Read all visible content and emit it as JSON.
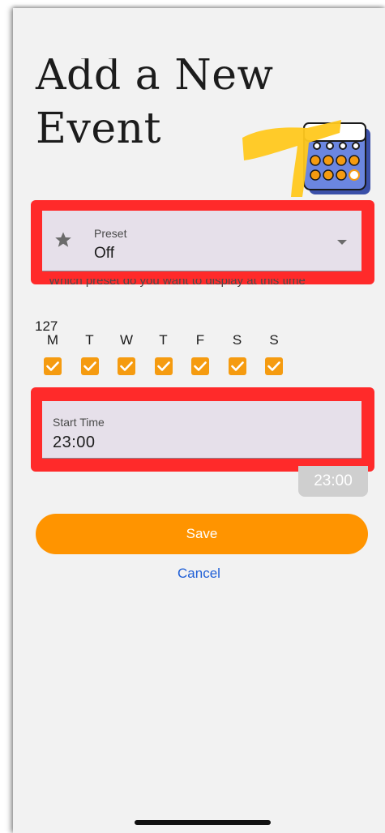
{
  "header": {
    "title_line1": "Add a New",
    "title_line2": "Event"
  },
  "preset": {
    "label": "Preset",
    "value": "Off",
    "helper": "Which preset do you want to display at this time",
    "icon": "star-icon"
  },
  "days": {
    "count": "127",
    "letters": [
      "M",
      "T",
      "W",
      "T",
      "F",
      "S",
      "S"
    ],
    "checked": [
      true,
      true,
      true,
      true,
      true,
      true,
      true
    ]
  },
  "start_time": {
    "label": "Start Time",
    "value": "23:00"
  },
  "time_chip": {
    "value": "23:00"
  },
  "actions": {
    "save_label": "Save",
    "cancel_label": "Cancel"
  },
  "colors": {
    "accent": "#ff9400",
    "checkbox": "#f59b10",
    "link": "#1f5fd6",
    "highlight": "#ff2a2a",
    "field_bg": "#e6e0ea"
  }
}
